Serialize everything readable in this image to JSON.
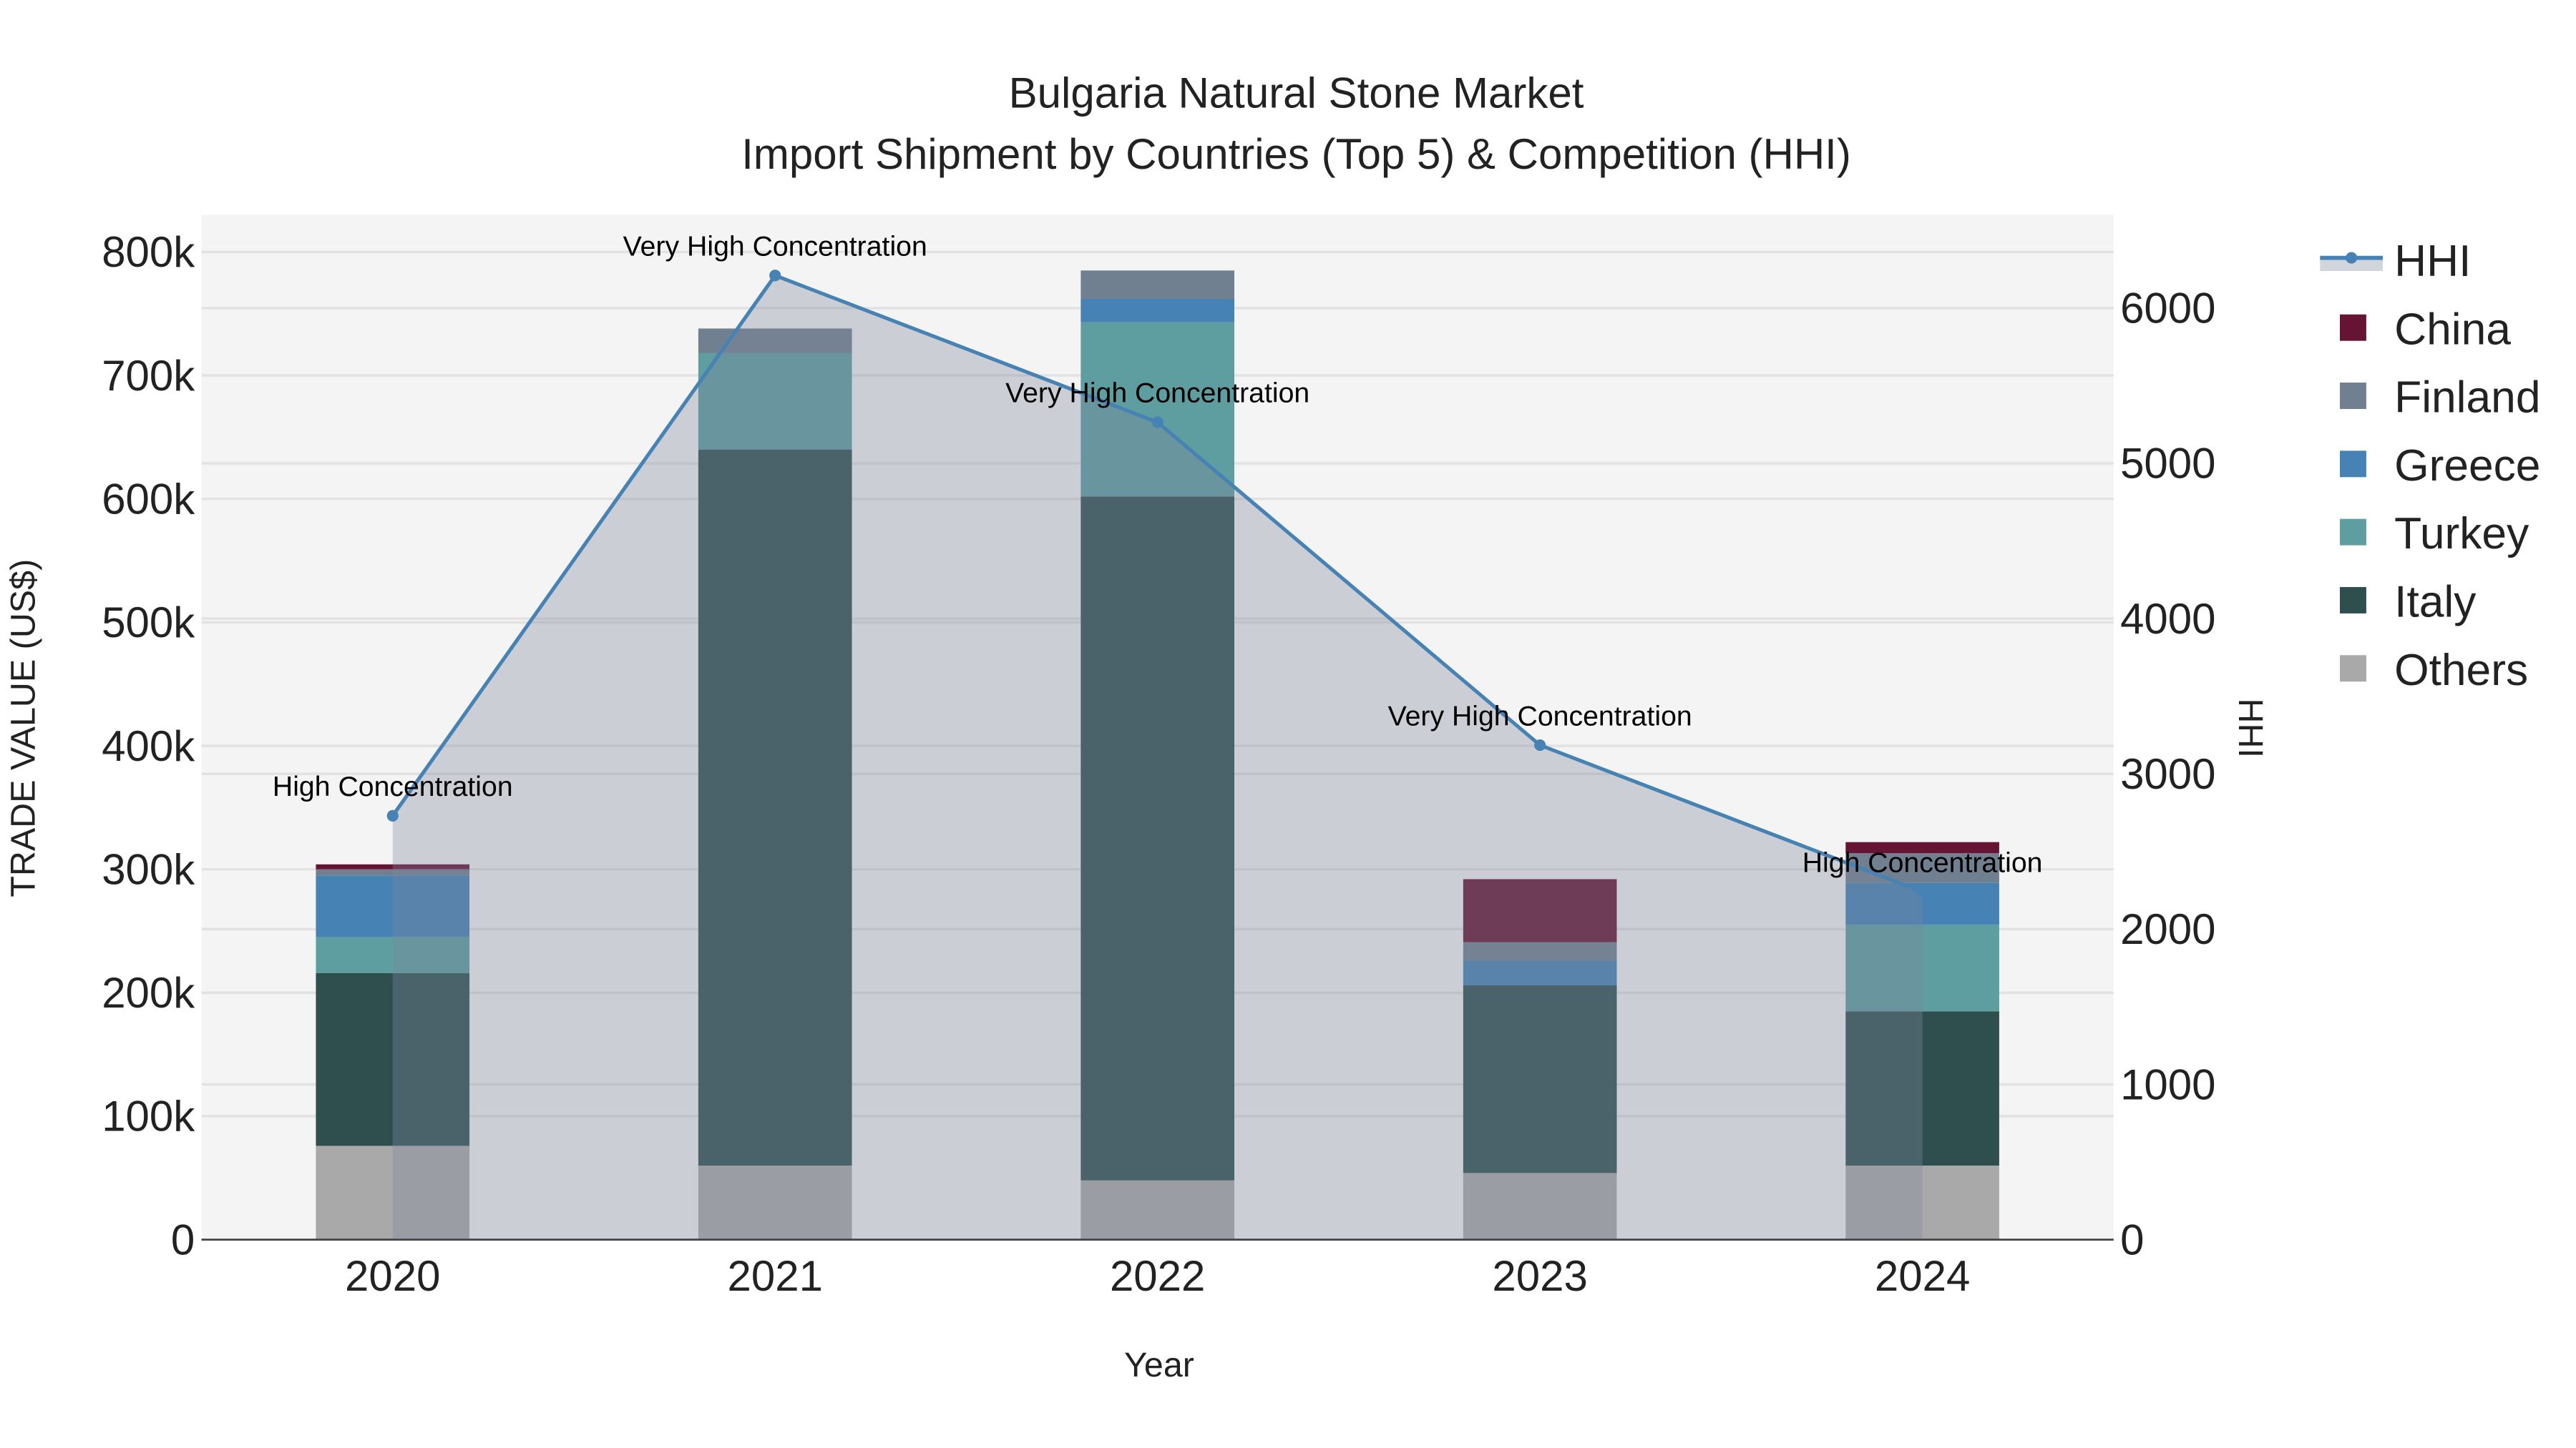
{
  "chart_data": {
    "type": "bar",
    "title": "Bulgaria Natural Stone Market",
    "subtitle": "Import Shipment by Countries (Top 5) & Competition (HHI)",
    "xlabel": "Year",
    "ylabel": "TRADE VALUE (US$)",
    "y2label": "HHI",
    "categories": [
      "2020",
      "2021",
      "2022",
      "2023",
      "2024"
    ],
    "ylim": [
      0,
      830000
    ],
    "y_ticks": [
      0,
      100000,
      200000,
      300000,
      400000,
      500000,
      600000,
      700000,
      800000
    ],
    "y_tick_labels": [
      "0",
      "100k",
      "200k",
      "300k",
      "400k",
      "500k",
      "600k",
      "700k",
      "800k"
    ],
    "y2lim": [
      0,
      6600
    ],
    "y2_ticks": [
      0,
      1000,
      2000,
      3000,
      4000,
      5000,
      6000
    ],
    "y2_tick_labels": [
      "0",
      "1000",
      "2000",
      "3000",
      "4000",
      "5000",
      "6000"
    ],
    "stacked": true,
    "series": [
      {
        "name": "Others",
        "color": "#A9A9A9",
        "values": [
          76000,
          60000,
          48000,
          54000,
          60000
        ]
      },
      {
        "name": "Italy",
        "color": "#2F4F4F",
        "values": [
          140000,
          580000,
          554000,
          152000,
          125000
        ]
      },
      {
        "name": "Turkey",
        "color": "#5F9EA0",
        "values": [
          29000,
          78000,
          141000,
          0,
          70000
        ]
      },
      {
        "name": "Greece",
        "color": "#4682B4",
        "values": [
          50000,
          0,
          19000,
          20000,
          34000
        ]
      },
      {
        "name": "Finland",
        "color": "#708090",
        "values": [
          5000,
          20000,
          23000,
          15000,
          24000
        ]
      },
      {
        "name": "China",
        "color": "#661434",
        "values": [
          4000,
          0,
          0,
          51000,
          9000
        ]
      }
    ],
    "line_series": {
      "name": "HHI",
      "color": "#4682B4",
      "axis": "right",
      "values": [
        2730,
        6210,
        5265,
        3185,
        2240
      ],
      "annotations": [
        "High Concentration",
        "Very High Concentration",
        "Very High Concentration",
        "Very High Concentration",
        "High Concentration"
      ]
    },
    "legend": {
      "placement": "right",
      "items": [
        "HHI",
        "China",
        "Finland",
        "Greece",
        "Turkey",
        "Italy",
        "Others"
      ]
    },
    "grid": true
  }
}
